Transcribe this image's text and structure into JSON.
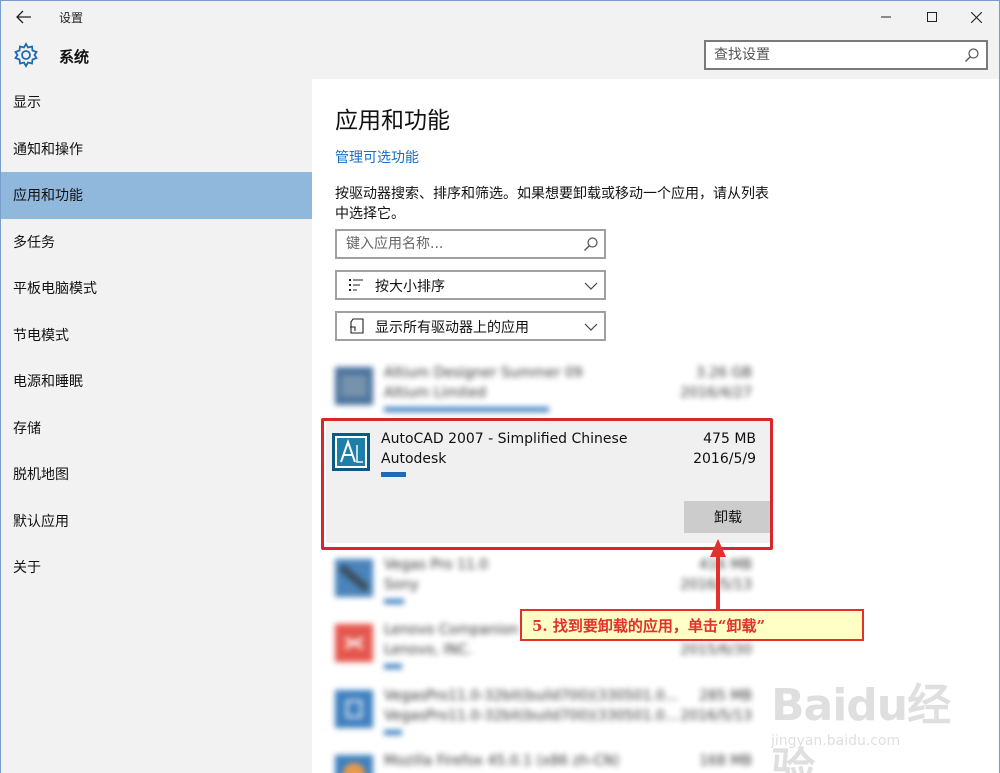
{
  "window": {
    "title": "设置"
  },
  "sidebar": {
    "title": "系统",
    "items": [
      {
        "label": "显示"
      },
      {
        "label": "通知和操作"
      },
      {
        "label": "应用和功能",
        "active": true
      },
      {
        "label": "多任务"
      },
      {
        "label": "平板电脑模式"
      },
      {
        "label": "节电模式"
      },
      {
        "label": "电源和睡眠"
      },
      {
        "label": "存储"
      },
      {
        "label": "脱机地图"
      },
      {
        "label": "默认应用"
      },
      {
        "label": "关于"
      }
    ]
  },
  "search": {
    "placeholder": "查找设置"
  },
  "main": {
    "title": "应用和功能",
    "link": "管理可选功能",
    "description": "按驱动器搜索、排序和筛选。如果想要卸载或移动一个应用，请从列表中选择它。",
    "app_search_placeholder": "键入应用名称...",
    "sort_label": "按大小排序",
    "drive_label": "显示所有驱动器上的应用",
    "apps": [
      {
        "name": "Altium Designer Summer 09",
        "publisher": "Altium Limited",
        "size": "3.26 GB",
        "date": "2016/4/27",
        "bar": 0.92
      },
      {
        "name": "AutoCAD 2007 - Simplified Chinese",
        "publisher": "Autodesk",
        "size": "475 MB",
        "date": "2016/5/9",
        "bar": 0.1,
        "selected": true
      },
      {
        "name": "Vegas Pro 11.0",
        "publisher": "Sony",
        "size": "416 MB",
        "date": "2016/5/13",
        "bar": 0.08
      },
      {
        "name": "Lenovo Companion",
        "publisher": "Lenovo, INC.",
        "size": "",
        "date": "2015/6/30",
        "bar": 0.05
      },
      {
        "name": "VegasPro11.0-32bit(build700)(330501.0...",
        "publisher": "VegasPro11.0-32bit(build700)(330501.0...",
        "size": "285 MB",
        "date": "2016/5/13",
        "bar": 0.05
      },
      {
        "name": "Mozilla Firefox 45.0.1 (x86 zh-CN)",
        "publisher": "",
        "size": "168 MB",
        "date": "",
        "bar": 0.0
      }
    ],
    "uninstall_label": "卸载"
  },
  "annotation": {
    "text": "5. 找到要卸载的应用，单击“卸载”"
  },
  "watermark": {
    "logo": "Baidu经验",
    "url": "jingyan.baidu.com"
  },
  "colors": {
    "accent": "#1f6ab4",
    "sidebar_active": "#8fb8dc",
    "annotation_red": "#e2302c"
  }
}
